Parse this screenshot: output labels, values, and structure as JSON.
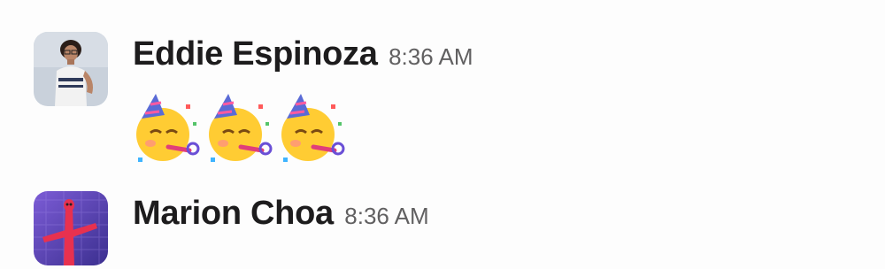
{
  "messages": [
    {
      "sender": "Eddie Espinoza",
      "timestamp": "8:36 AM",
      "avatar_icon": "user-photo",
      "emoji": [
        "partying-face",
        "partying-face",
        "partying-face"
      ]
    },
    {
      "sender": "Marion Choa",
      "timestamp": "8:36 AM",
      "avatar_icon": "inflatable-tube-man-photo"
    }
  ],
  "colors": {
    "name_text": "#1d1c1d",
    "timestamp_text": "#616061",
    "background": "#fdfdfd"
  }
}
